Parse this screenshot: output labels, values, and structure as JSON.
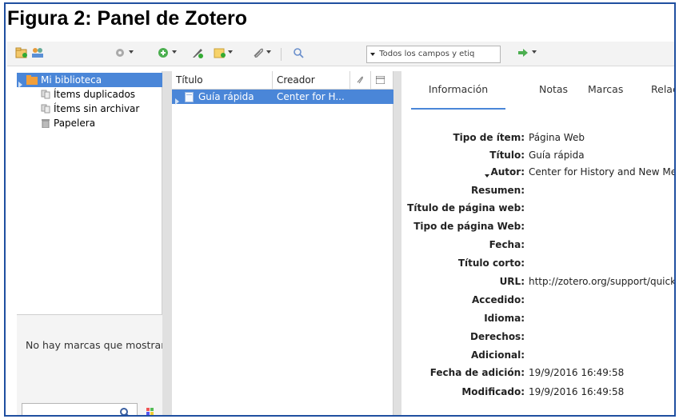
{
  "caption": "Figura 2: Panel de Zotero",
  "toolbar": {
    "search_mode_label": "Todos los campos y etiq",
    "icons": [
      "new-collection-icon",
      "new-group-icon",
      "gear-icon",
      "new-item-icon",
      "add-by-identifier-icon",
      "new-note-icon",
      "attachment-icon",
      "search-icon",
      "locate-icon"
    ]
  },
  "library": {
    "items": [
      {
        "label": "Mi biblioteca",
        "icon": "library-icon",
        "selected": true
      },
      {
        "label": "Ítems duplicados",
        "icon": "duplicates-icon"
      },
      {
        "label": "Ítems sin archivar",
        "icon": "unfiled-icon"
      },
      {
        "label": "Papelera",
        "icon": "trash-icon"
      }
    ]
  },
  "tags": {
    "empty_text": "No hay marcas que mostrar"
  },
  "items_list": {
    "columns": {
      "title": "Título",
      "creator": "Creador"
    },
    "rows": [
      {
        "title": "Guía rápida",
        "creator": "Center for H..."
      }
    ]
  },
  "item_pane": {
    "tabs": [
      "Información",
      "Notas",
      "Marcas",
      "Relac"
    ],
    "fields": [
      {
        "label": "Tipo de ítem:",
        "value": "Página Web"
      },
      {
        "label": "Título:",
        "value": "Guía rápida"
      },
      {
        "label": "Autor:",
        "value": "Center for History and New Me"
      },
      {
        "label": "Resumen:",
        "value": ""
      },
      {
        "label": "Título de página web:",
        "value": ""
      },
      {
        "label": "Tipo de página Web:",
        "value": ""
      },
      {
        "label": "Fecha:",
        "value": ""
      },
      {
        "label": "Título corto:",
        "value": ""
      },
      {
        "label": "URL:",
        "value": "http://zotero.org/support/quick"
      },
      {
        "label": "Accedido:",
        "value": ""
      },
      {
        "label": "Idioma:",
        "value": ""
      },
      {
        "label": "Derechos:",
        "value": ""
      },
      {
        "label": "Adicional:",
        "value": ""
      },
      {
        "label": "Fecha de adición:",
        "value": "19/9/2016 16:49:58"
      },
      {
        "label": "Modificado:",
        "value": "19/9/2016 16:49:58"
      }
    ]
  },
  "colors": {
    "selection": "#4a86d8",
    "frame": "#1f4fa0"
  }
}
